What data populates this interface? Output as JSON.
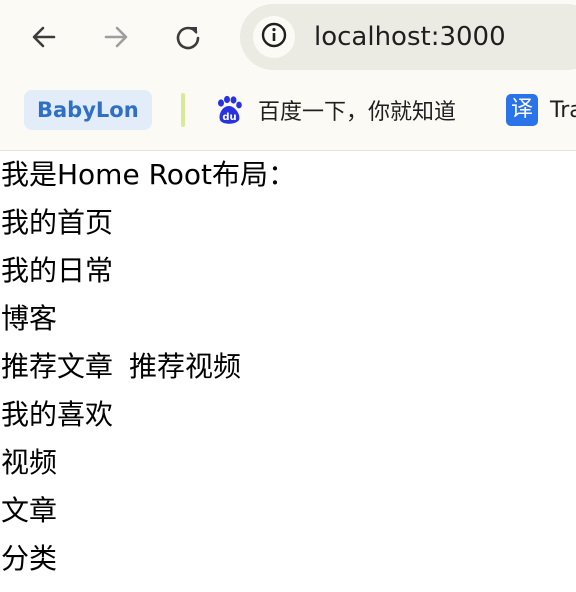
{
  "browser": {
    "url": "localhost:3000",
    "nav": {
      "back_icon": "arrow-left-icon",
      "forward_icon": "arrow-right-icon",
      "reload_icon": "reload-icon",
      "site_info_icon": "info-circle-icon"
    }
  },
  "bookmarks": {
    "items": [
      {
        "label": "BabyLon",
        "color": "#2f6fc4",
        "bg": "#e3edf9"
      },
      {
        "label": "百度一下，你就知道",
        "icon": "baidu-icon"
      },
      {
        "label": "Tra",
        "icon": "translate-icon",
        "icon_text": "译"
      }
    ]
  },
  "page": {
    "lines": [
      "我是Home Root布局：",
      "我的首页",
      "我的日常",
      "博客",
      "推荐文章",
      "推荐视频",
      "我的喜欢",
      "视频",
      "文章",
      "分类"
    ]
  }
}
